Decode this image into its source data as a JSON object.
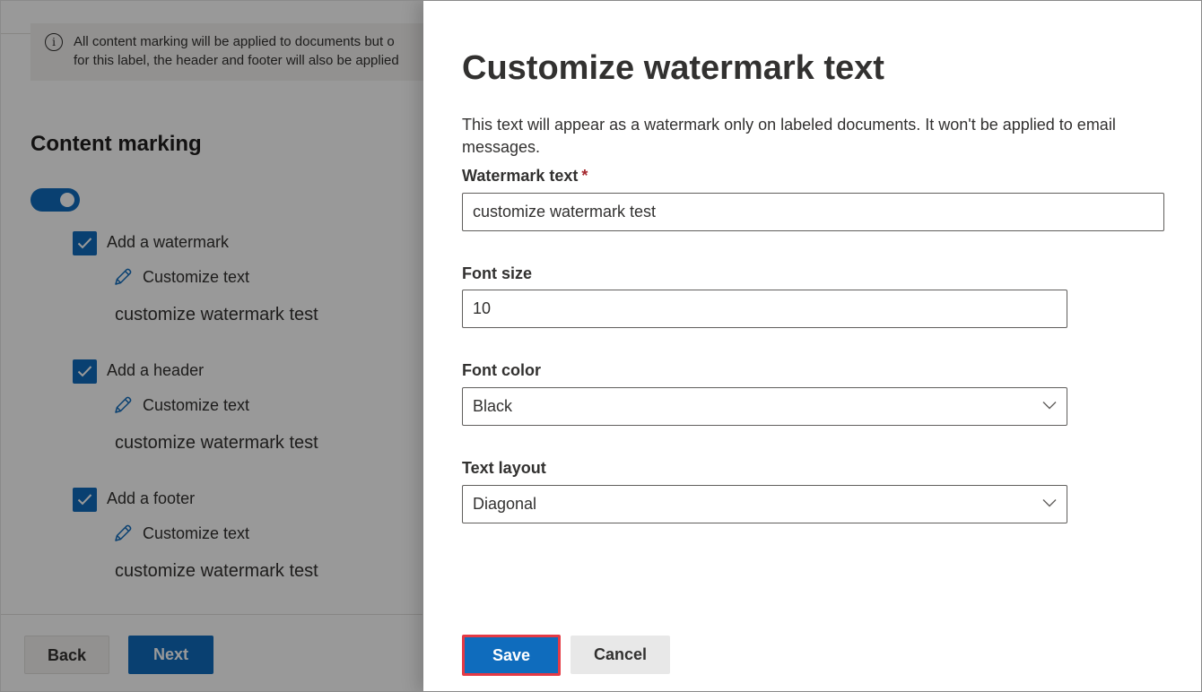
{
  "background": {
    "info_lines": [
      "All content marking will be applied to documents but o",
      "for this label, the header and footer will also be applied"
    ],
    "section_title": "Content marking",
    "toggle_on": true,
    "items": [
      {
        "label": "Add a watermark",
        "edit_label": "Customize text",
        "value": "customize watermark test",
        "checked": true
      },
      {
        "label": "Add a header",
        "edit_label": "Customize text",
        "value": "customize watermark test",
        "checked": true
      },
      {
        "label": "Add a footer",
        "edit_label": "Customize text",
        "value": "customize watermark test",
        "checked": true
      }
    ],
    "back_label": "Back",
    "next_label": "Next"
  },
  "panel": {
    "title": "Customize watermark text",
    "description": "This text will appear as a watermark only on labeled documents. It won't be applied to email messages.",
    "watermark_text": {
      "label": "Watermark text",
      "required_mark": "*",
      "value": "customize watermark test"
    },
    "font_size": {
      "label": "Font size",
      "value": "10"
    },
    "font_color": {
      "label": "Font color",
      "value": "Black"
    },
    "text_layout": {
      "label": "Text layout",
      "value": "Diagonal"
    },
    "save_label": "Save",
    "cancel_label": "Cancel"
  },
  "colors": {
    "accent": "#0f6cbd",
    "highlight": "#e53a45",
    "required": "#a4262c"
  }
}
